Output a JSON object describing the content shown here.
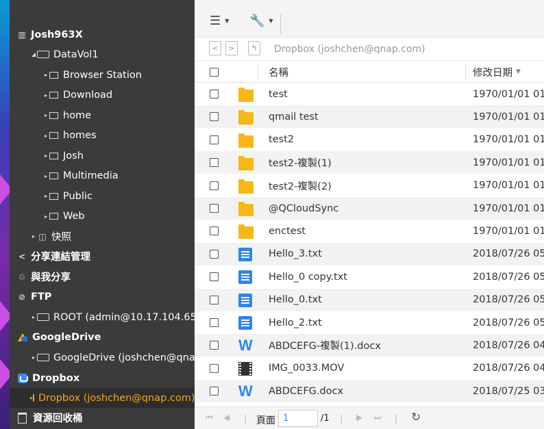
{
  "sidebar": {
    "root": "Josh963X",
    "volume": "DataVol1",
    "shares": [
      "Browser Station",
      "Download",
      "home",
      "homes",
      "Josh",
      "Multimedia",
      "Public",
      "Web"
    ],
    "snapshot": "快照",
    "share_link_mgmt": "分享連結管理",
    "shared_with_me": "與我分享",
    "ftp": "FTP",
    "ftp_child": "ROOT (admin@10.17.104.65)",
    "googledrive": "GoogleDrive",
    "googledrive_child": "GoogleDrive (joshchen@qnap.com)",
    "dropbox": "Dropbox",
    "dropbox_child": "Dropbox (joshchen@qnap.com)",
    "recycle": "資源回收桶"
  },
  "toolbar": {
    "list_icon": "list-icon",
    "tools_icon": "wrench-icon"
  },
  "path": {
    "text": "Dropbox (joshchen@qnap.com)"
  },
  "table": {
    "col_name": "名稱",
    "col_modified": "修改日期",
    "sort_indicator": "▼",
    "rows": [
      {
        "type": "folder",
        "name": "test",
        "date": "1970/01/01 01"
      },
      {
        "type": "folder",
        "name": "qmail test",
        "date": "1970/01/01 01"
      },
      {
        "type": "folder",
        "name": "test2",
        "date": "1970/01/01 01"
      },
      {
        "type": "folder",
        "name": "test2-複製(1)",
        "date": "1970/01/01 01"
      },
      {
        "type": "folder",
        "name": "test2-複製(2)",
        "date": "1970/01/01 01"
      },
      {
        "type": "folder",
        "name": "@QCloudSync",
        "date": "1970/01/01 01"
      },
      {
        "type": "folder",
        "name": "enctest",
        "date": "1970/01/01 01"
      },
      {
        "type": "txt",
        "name": "Hello_3.txt",
        "date": "2018/07/26 05"
      },
      {
        "type": "txt",
        "name": "Hello_0 copy.txt",
        "date": "2018/07/26 05"
      },
      {
        "type": "txt",
        "name": "Hello_0.txt",
        "date": "2018/07/26 05"
      },
      {
        "type": "txt",
        "name": "Hello_2.txt",
        "date": "2018/07/26 05"
      },
      {
        "type": "docx",
        "name": "ABDCEFG-複製(1).docx",
        "date": "2018/07/26 04"
      },
      {
        "type": "mov",
        "name": "IMG_0033.MOV",
        "date": "2018/07/26 04"
      },
      {
        "type": "docx",
        "name": "ABDCEFG.docx",
        "date": "2018/07/25 03"
      }
    ]
  },
  "footer": {
    "page_label": "頁面",
    "page_value": "1",
    "page_total": "/1"
  },
  "colors": {
    "accent": "#f5a623",
    "sidebar_bg": "#3b3b3b",
    "folder": "#f9b715",
    "file_blue": "#2f86e9"
  }
}
